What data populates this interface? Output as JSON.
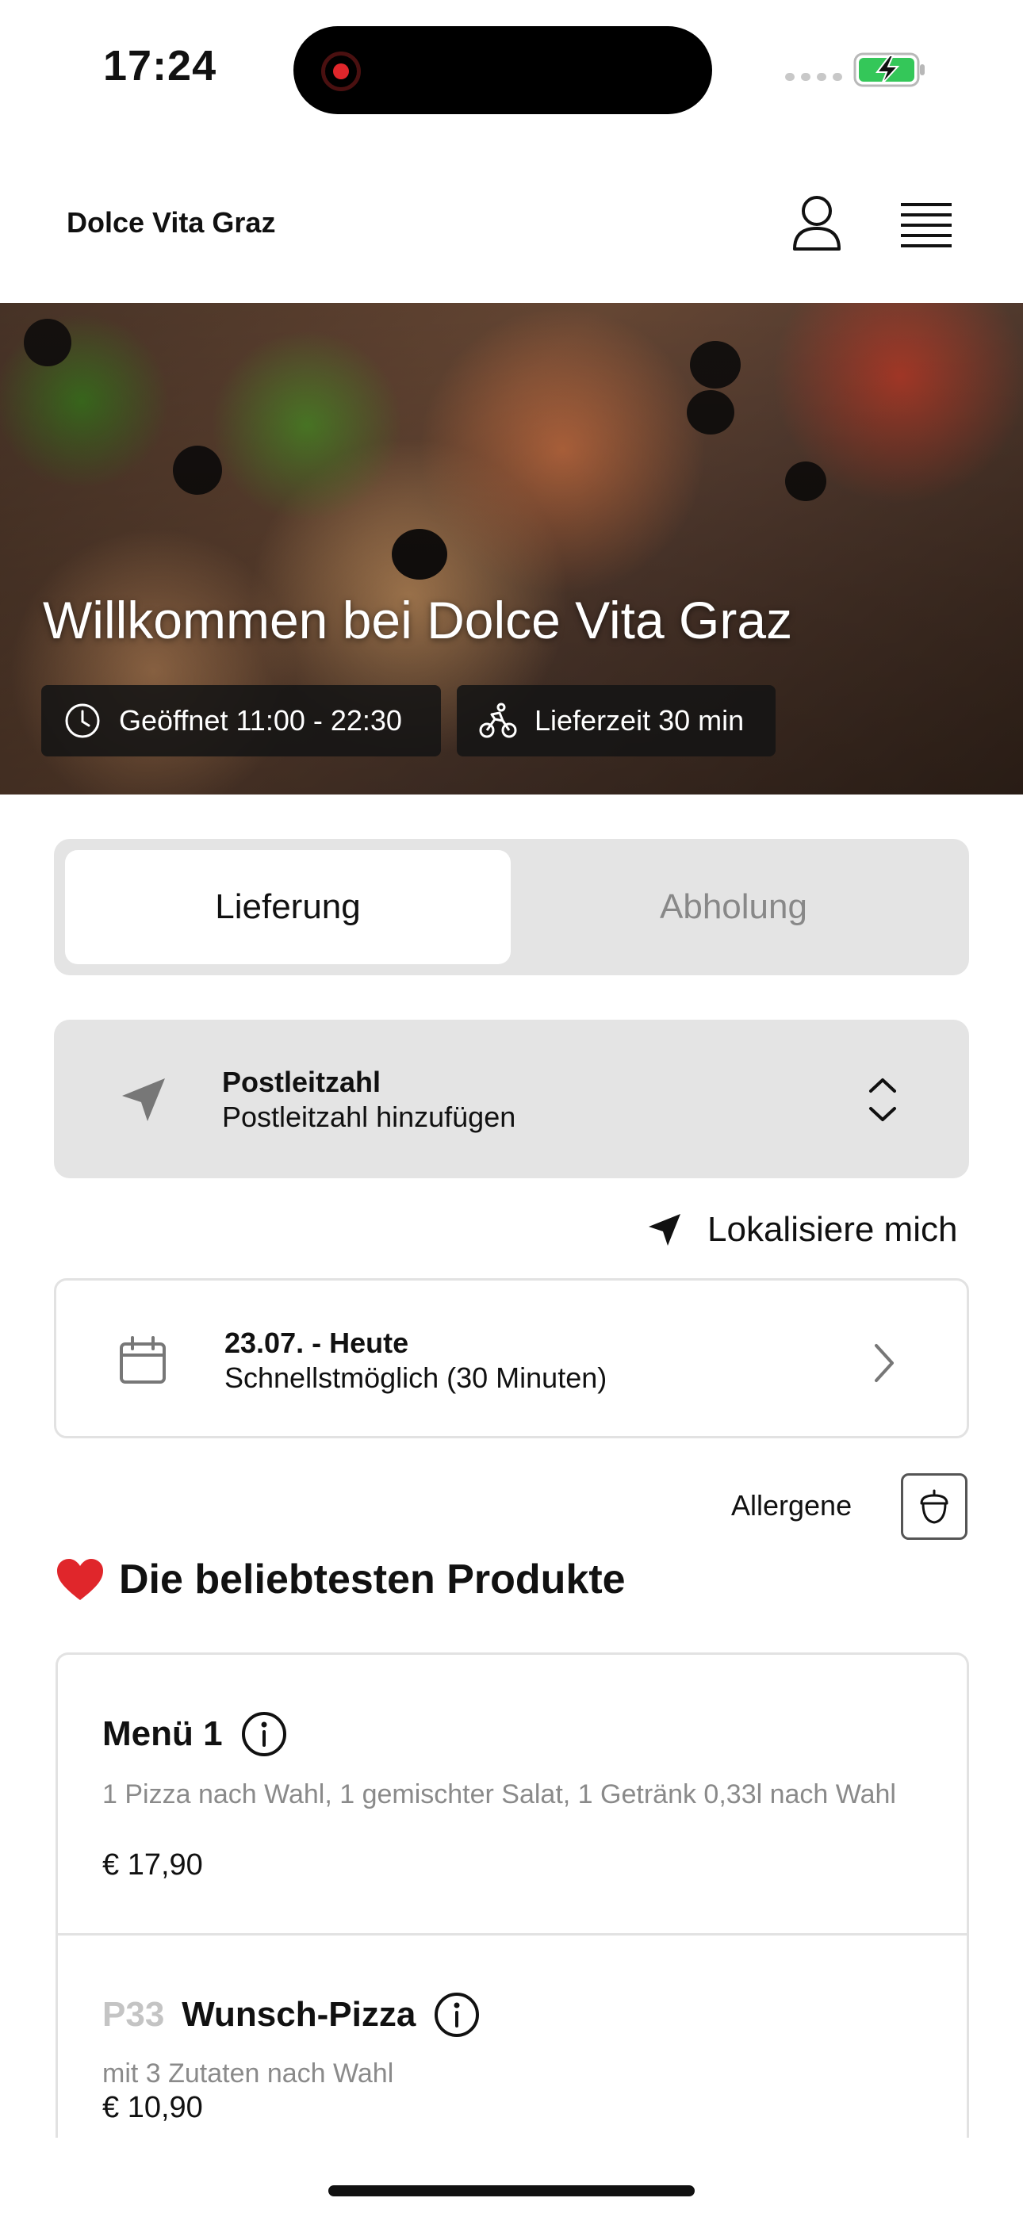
{
  "status_bar": {
    "time": "17:24"
  },
  "header": {
    "brand": "Dolce Vita Graz"
  },
  "hero": {
    "title": "Willkommen bei Dolce Vita Graz",
    "opening_hours": "Geöffnet 11:00 - 22:30",
    "delivery_time": "Lieferzeit 30 min"
  },
  "order_mode": {
    "options": [
      "Lieferung",
      "Abholung"
    ],
    "selected": "Lieferung"
  },
  "postal": {
    "label": "Postleitzahl",
    "placeholder": "Postleitzahl hinzufügen"
  },
  "locate": {
    "label": "Lokalisiere mich"
  },
  "schedule": {
    "date": "23.07. - Heute",
    "time": "Schnellstmöglich (30 Minuten)"
  },
  "allergens": {
    "label": "Allergene"
  },
  "section": {
    "title": "Die beliebtesten Produkte",
    "icon": "heart-icon"
  },
  "products": [
    {
      "code": "",
      "name": "Menü 1",
      "description": "1 Pizza nach Wahl, 1 gemischter Salat, 1 Getränk 0,33l nach Wahl",
      "price": "€ 17,90"
    },
    {
      "code": "P33",
      "name": "Wunsch-Pizza",
      "description": "mit 3 Zutaten nach Wahl",
      "price": "€ 10,90"
    }
  ],
  "colors": {
    "accent_battery": "#34c759",
    "segment_bg": "#e4e4e4",
    "heart": "#e0262b"
  }
}
